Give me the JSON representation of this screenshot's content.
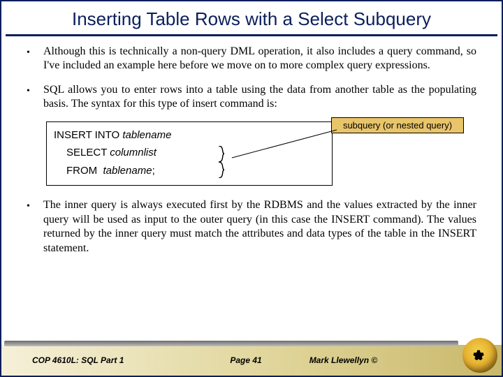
{
  "title": "Inserting Table Rows with a Select Subquery",
  "bullets": {
    "b1": "Although this is technically a non-query DML operation, it also includes a query command, so I've included an example here before we move on to more complex query expressions.",
    "b2": "SQL allows you to enter rows into a table using the data from another table as the populating basis.  The syntax for this type of insert command is:",
    "b3": "The inner query is always executed first by the RDBMS and the values extracted by the inner query will be used as input to the outer query (in this case the INSERT command).  The values returned by the inner query must match the attributes and data types of the table in the INSERT statement."
  },
  "syntax": {
    "line1_kw": "INSERT INTO ",
    "line1_it": "tablename",
    "line2_kw": "SELECT ",
    "line2_it": "columnlist",
    "line3_kw": "FROM  ",
    "line3_it": "tablename",
    "line3_end": ";"
  },
  "callout": "subquery (or nested query)",
  "footer": {
    "left": "COP 4610L: SQL Part 1",
    "center": "Page 41",
    "right": "Mark Llewellyn ©"
  }
}
